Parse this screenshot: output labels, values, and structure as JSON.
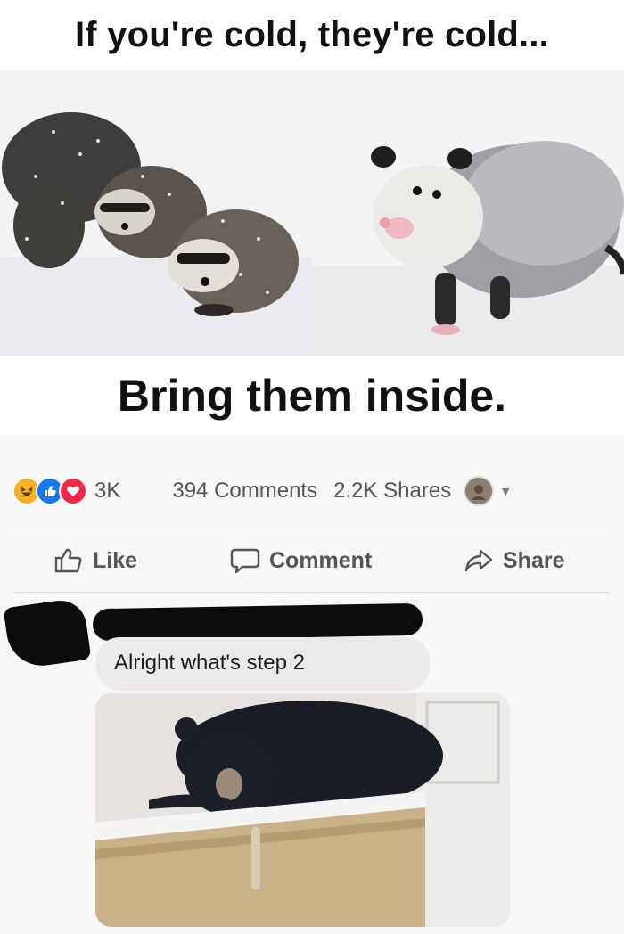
{
  "meme": {
    "top_text": "If you're cold, they're cold...",
    "bottom_text": "Bring them inside."
  },
  "post_stats": {
    "reactions_count": "3K",
    "comments": "394 Comments",
    "shares": "2.2K Shares"
  },
  "actions": {
    "like": "Like",
    "comment": "Comment",
    "share": "Share"
  },
  "comment": {
    "text": "Alright what's step 2"
  },
  "colors": {
    "like_blue": "#1877f2",
    "love_red": "#f0284a",
    "haha_yellow": "#f7b125"
  },
  "icons": [
    "haha-icon",
    "like-icon",
    "love-icon",
    "thumbs-up-icon",
    "speech-bubble-icon",
    "share-arrow-icon",
    "chevron-down-icon"
  ]
}
